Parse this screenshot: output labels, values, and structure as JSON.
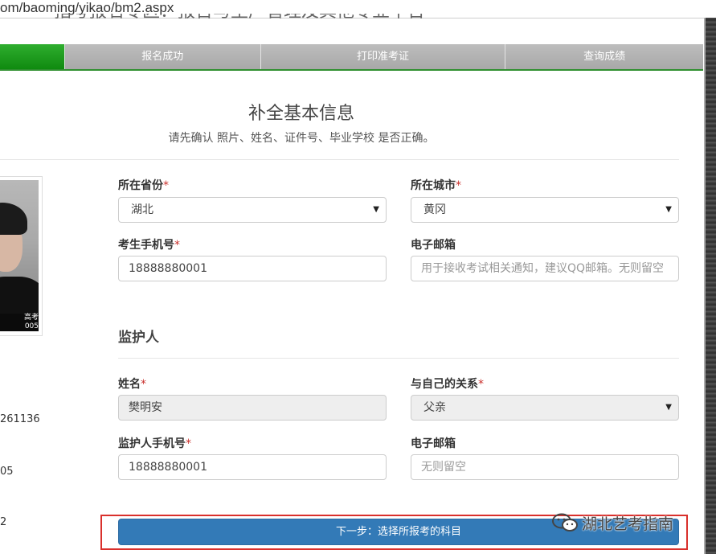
{
  "browser": {
    "url": "om/baoming/yikao/bm2.aspx"
  },
  "site": {
    "title": "**指考报名专区：报告与生产管理及其他专业平台"
  },
  "steps": [
    {
      "label": "",
      "active": true
    },
    {
      "label": "报名成功",
      "active": false
    },
    {
      "label": "打印准考证",
      "active": false
    },
    {
      "label": "查询成绩",
      "active": false
    }
  ],
  "form_header": {
    "title": "补全基本信息",
    "subtitle": "请先确认 照片、姓名、证件号、毕业学校 是否正确。"
  },
  "photo": {
    "caption_line1": "高考",
    "caption_line2": "005"
  },
  "left_info": {
    "line1": "261136",
    "line2": "05",
    "line3": "2"
  },
  "fields": {
    "province": {
      "label": "所在省份",
      "required": "*",
      "value": "湖北"
    },
    "city": {
      "label": "所在城市",
      "required": "*",
      "value": "黄冈"
    },
    "phone": {
      "label": "考生手机号",
      "required": "*",
      "value": "18888880001"
    },
    "email": {
      "label": "电子邮箱",
      "placeholder": "用于接收考试相关通知，建议QQ邮箱。无则留空"
    }
  },
  "guardian": {
    "section_title": "监护人",
    "name": {
      "label": "姓名",
      "required": "*",
      "value": "樊明安"
    },
    "relation": {
      "label": "与自己的关系",
      "required": "*",
      "value": "父亲"
    },
    "phone": {
      "label": "监护人手机号",
      "required": "*",
      "value": "18888880001"
    },
    "email": {
      "label": "电子邮箱",
      "placeholder": "无则留空"
    }
  },
  "next_button": {
    "label": "下一步：选择所报考的科目"
  },
  "watermark": {
    "text": "湖北艺考指南"
  },
  "icons": {
    "dropdown": "caret-down-icon",
    "wechat": "wechat-icon"
  }
}
